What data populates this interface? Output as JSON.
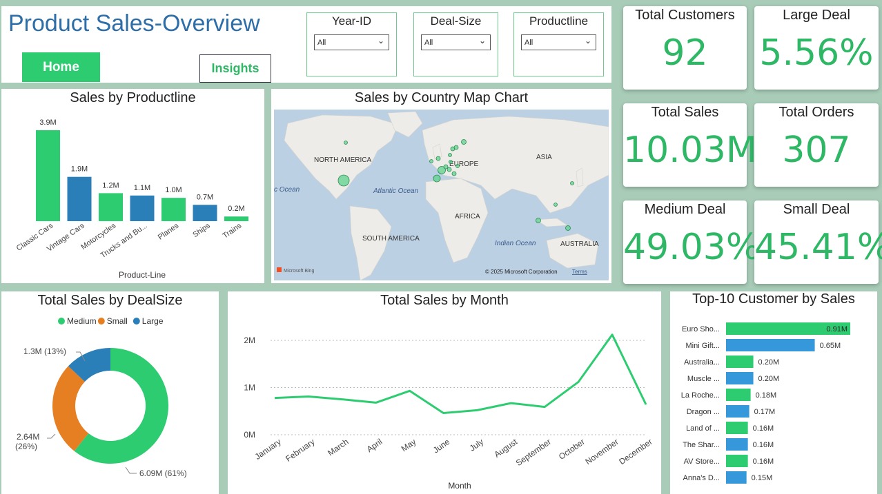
{
  "header": {
    "title": "Product Sales-Overview",
    "home_label": "Home",
    "insights_label": "Insights"
  },
  "slicers": [
    {
      "label": "Year-ID",
      "value": "All"
    },
    {
      "label": "Deal-Size",
      "value": "All"
    },
    {
      "label": "Productline",
      "value": "All"
    }
  ],
  "kpis": {
    "total_customers": {
      "label": "Total Customers",
      "value": "92"
    },
    "large_deal": {
      "label": "Large Deal",
      "value": "5.56%"
    },
    "total_sales": {
      "label": "Total Sales",
      "value": "10.03M"
    },
    "total_orders": {
      "label": "Total Orders",
      "value": "307"
    },
    "medium_deal": {
      "label": "Medium Deal",
      "value": "49.03%"
    },
    "small_deal": {
      "label": "Small Deal",
      "value": "45.41%"
    }
  },
  "map": {
    "title": "Sales by Country Map Chart",
    "labels": {
      "north_america": "NORTH AMERICA",
      "europe": "EUROPE",
      "asia": "ASIA",
      "africa": "AFRICA",
      "south_america": "SOUTH AMERICA",
      "australia": "AUSTRALIA",
      "atlantic": "Atlantic Ocean",
      "indian": "Indian Ocean",
      "pacific_partial": "c Ocean"
    },
    "logo": "Microsoft Bing",
    "copyright": "© 2025 Microsoft Corporation",
    "terms": "Terms"
  },
  "colors": {
    "green": "#2ecc71",
    "blue": "#2b7fb8",
    "orange": "#e67e22",
    "kpi_text": "#2eb866",
    "title_blue": "#2e6ea8"
  },
  "chart_data": [
    {
      "type": "bar",
      "title": "Sales by Productline",
      "xlabel": "Product-Line",
      "categories": [
        "Classic Cars",
        "Vintage Cars",
        "Motorcycles",
        "Trucks and Bu...",
        "Planes",
        "Ships",
        "Trains"
      ],
      "values": [
        3.9,
        1.9,
        1.2,
        1.1,
        1.0,
        0.7,
        0.2
      ],
      "value_labels": [
        "3.9M",
        "1.9M",
        "1.2M",
        "1.1M",
        "1.0M",
        "0.7M",
        "0.2M"
      ],
      "bar_colors": [
        "#2ecc71",
        "#2b7fb8",
        "#2ecc71",
        "#2b7fb8",
        "#2ecc71",
        "#2b7fb8",
        "#2ecc71"
      ]
    },
    {
      "type": "pie",
      "title": "Total Sales by DealSize",
      "legend": [
        "Medium",
        "Small",
        "Large"
      ],
      "legend_position": "top",
      "slices": [
        {
          "name": "Medium",
          "value": 6.09,
          "label": "6.09M (61%)",
          "color": "#2ecc71"
        },
        {
          "name": "Small",
          "value": 2.64,
          "label": "2.64M (26%)",
          "color": "#e67e22"
        },
        {
          "name": "Large",
          "value": 1.3,
          "label": "1.3M (13%)",
          "color": "#2b7fb8"
        }
      ]
    },
    {
      "type": "line",
      "title": "Total Sales by Month",
      "xlabel": "Month",
      "categories": [
        "January",
        "February",
        "March",
        "April",
        "May",
        "June",
        "July",
        "August",
        "September",
        "October",
        "November",
        "December"
      ],
      "values": [
        0.78,
        0.81,
        0.75,
        0.68,
        0.93,
        0.46,
        0.52,
        0.67,
        0.59,
        1.12,
        2.12,
        0.64
      ],
      "yticks": [
        {
          "v": 0,
          "label": "0M"
        },
        {
          "v": 1,
          "label": "1M"
        },
        {
          "v": 2,
          "label": "2M"
        }
      ],
      "ylim": [
        0,
        2.2
      ],
      "grid": true,
      "color": "#2ecc71"
    },
    {
      "type": "bar",
      "orientation": "horizontal",
      "title": "Top-10 Customer by Sales",
      "categories": [
        "Euro Sho...",
        "Mini Gift...",
        "Australia...",
        "Muscle ...",
        "La Roche...",
        "Dragon ...",
        "Land of ...",
        "The Shar...",
        "AV Store...",
        "Anna's D..."
      ],
      "values": [
        0.91,
        0.65,
        0.2,
        0.2,
        0.18,
        0.17,
        0.16,
        0.16,
        0.16,
        0.15
      ],
      "value_labels": [
        "0.91M",
        "0.65M",
        "0.20M",
        "0.20M",
        "0.18M",
        "0.17M",
        "0.16M",
        "0.16M",
        "0.16M",
        "0.15M"
      ],
      "bar_colors": [
        "#2ecc71",
        "#3498db",
        "#2ecc71",
        "#3498db",
        "#2ecc71",
        "#3498db",
        "#2ecc71",
        "#3498db",
        "#2ecc71",
        "#3498db"
      ]
    }
  ]
}
